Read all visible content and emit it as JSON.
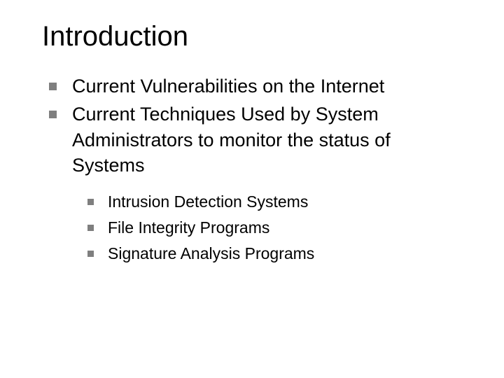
{
  "slide": {
    "title": "Introduction",
    "bullets": [
      {
        "text": "Current Vulnerabilities on the Internet"
      },
      {
        "text": "Current Techniques Used by System Administrators to monitor the status of Systems",
        "sub": [
          "Intrusion Detection Systems",
          "File Integrity Programs",
          "Signature Analysis Programs"
        ]
      }
    ]
  }
}
